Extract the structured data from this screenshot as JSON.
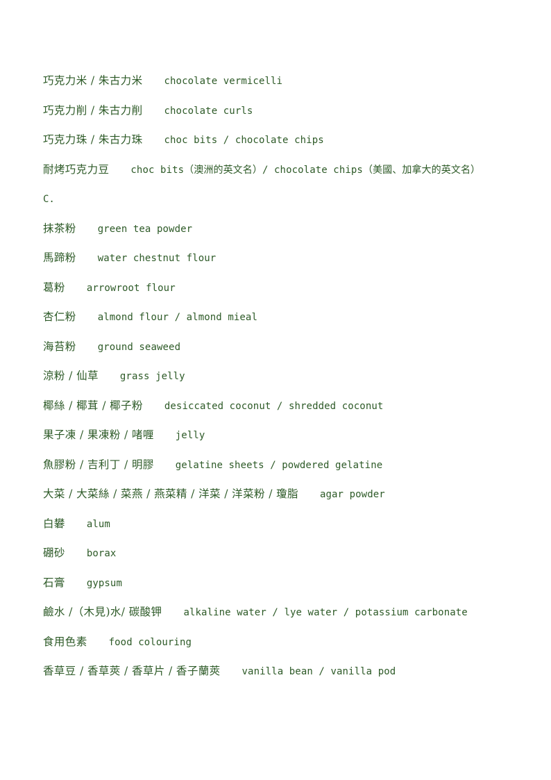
{
  "document": {
    "page_background": "#ffffff",
    "text_color": "#2d5a27",
    "type": "bilingual-glossary",
    "section_marker": "C."
  },
  "glossary": {
    "entries": [
      {
        "term": "巧克力米 / 朱古力米",
        "gloss": "chocolate vermicelli",
        "kind": "entry"
      },
      {
        "term": "巧克力削 / 朱古力削",
        "gloss": "chocolate curls",
        "kind": "entry"
      },
      {
        "term": "巧克力珠 / 朱古力珠",
        "gloss": "choc bits / chocolate chips",
        "kind": "entry"
      },
      {
        "term": "耐烤巧克力豆",
        "gloss": "choc bits（澳洲的英文名）/ chocolate chips（美國、加拿大的英文名）",
        "kind": "entry"
      },
      {
        "term": "C.",
        "gloss": "",
        "kind": "marker"
      },
      {
        "term": "抹茶粉",
        "gloss": "green tea powder",
        "kind": "entry"
      },
      {
        "term": "馬蹄粉",
        "gloss": "water chestnut flour",
        "kind": "entry"
      },
      {
        "term": "葛粉",
        "gloss": "arrowroot flour",
        "kind": "entry"
      },
      {
        "term": "杏仁粉",
        "gloss": "almond flour / almond mieal",
        "kind": "entry"
      },
      {
        "term": "海苔粉",
        "gloss": "ground seaweed",
        "kind": "entry"
      },
      {
        "term": "涼粉 / 仙草",
        "gloss": "grass jelly",
        "kind": "entry"
      },
      {
        "term": "椰絲 / 椰茸 / 椰子粉",
        "gloss": "desiccated coconut / shredded coconut",
        "kind": "entry"
      },
      {
        "term": "果子凍 / 果凍粉 / 啫喱",
        "gloss": "jelly",
        "kind": "entry"
      },
      {
        "term": "魚膠粉 / 吉利丁 / 明膠",
        "gloss": "gelatine sheets / powdered gelatine",
        "kind": "entry"
      },
      {
        "term": "大菜 / 大菜絲 / 菜燕 / 燕菜精 / 洋菜 / 洋菜粉 / 瓊脂",
        "gloss": "agar powder",
        "kind": "entry"
      },
      {
        "term": "白礬",
        "gloss": "alum",
        "kind": "entry"
      },
      {
        "term": "硼砂",
        "gloss": "borax",
        "kind": "entry"
      },
      {
        "term": "石膏",
        "gloss": "gypsum",
        "kind": "entry"
      },
      {
        "term": "鹼水 /（木見)水/ 碳酸钾",
        "gloss": "alkaline water / lye water / potassium carbonate",
        "kind": "entry"
      },
      {
        "term": "食用色素",
        "gloss": "food colouring",
        "kind": "entry"
      },
      {
        "term": "香草豆 / 香草莢 / 香草片 / 香子蘭莢",
        "gloss": "vanilla bean / vanilla pod",
        "kind": "entry"
      }
    ]
  }
}
